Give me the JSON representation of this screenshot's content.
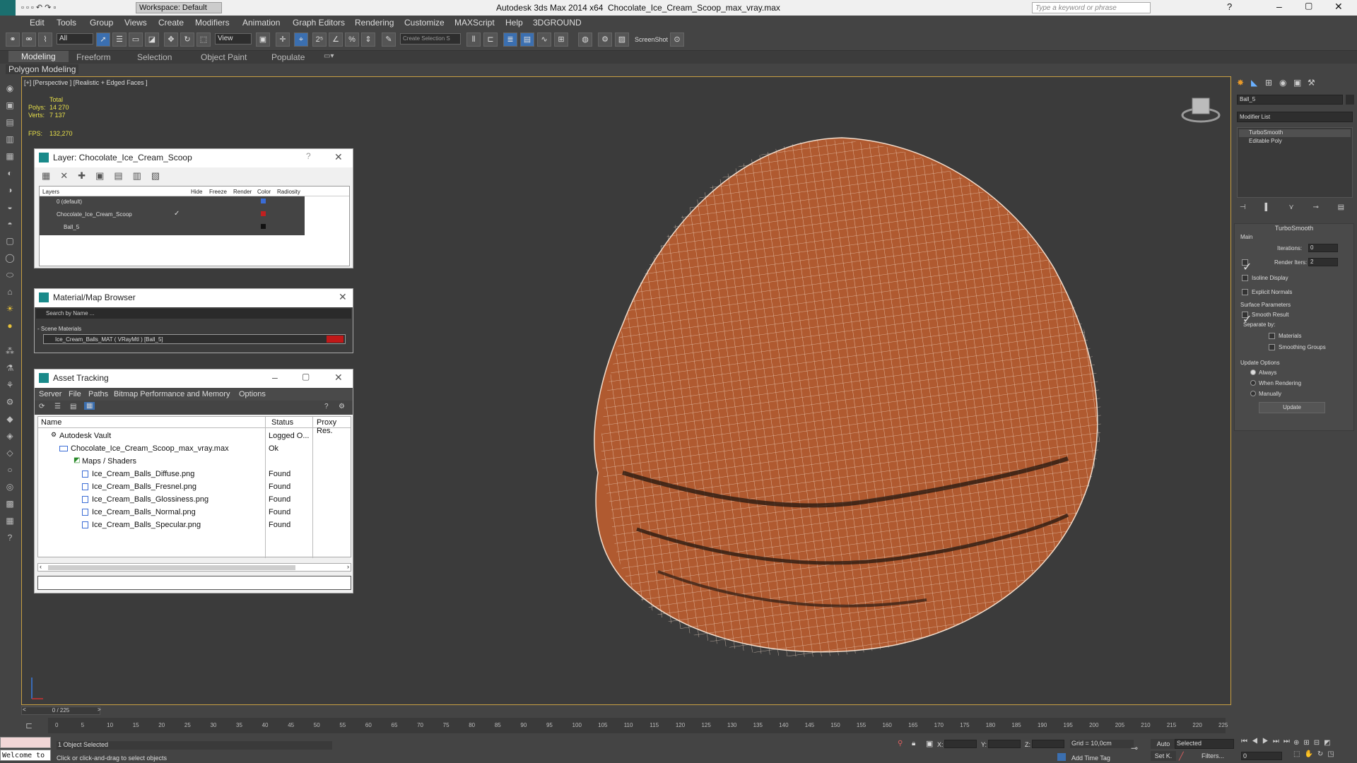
{
  "app": {
    "title": "Autodesk 3ds Max  2014 x64",
    "file": "Chocolate_Ice_Cream_Scoop_max_vray.max",
    "workspace": "Workspace: Default",
    "search_placeholder": "Type a keyword or phrase"
  },
  "menu": [
    "Edit",
    "Tools",
    "Group",
    "Views",
    "Create",
    "Modifiers",
    "Animation",
    "Graph Editors",
    "Rendering",
    "Customize",
    "MAXScript",
    "Help",
    "3DGROUND"
  ],
  "toolbar": {
    "filter": "All",
    "view": "View",
    "selection_set": "Create Selection S",
    "screenshot": "ScreenShot"
  },
  "ribbon": {
    "tabs": [
      "Modeling",
      "Freeform",
      "Selection",
      "Object Paint",
      "Populate"
    ],
    "sub": "Polygon Modeling"
  },
  "viewport": {
    "label": "[+] [Perspective ] [Realistic + Edged Faces ]",
    "stats": {
      "total": "Total",
      "polys_label": "Polys:",
      "polys": "14 270",
      "verts_label": "Verts:",
      "verts": "7 137",
      "fps_label": "FPS:",
      "fps": "132,270"
    }
  },
  "layer_dialog": {
    "title": "Layer: Chocolate_Ice_Cream_Scoop",
    "help": "?",
    "cols": [
      "Layers",
      "Hide",
      "Freeze",
      "Render",
      "Color",
      "Radiosity"
    ],
    "rows": [
      "0 (default)",
      "Chocolate_Ice_Cream_Scoop",
      "Ball_5"
    ]
  },
  "material_browser": {
    "title": "Material/Map Browser",
    "search": "Search by Name ...",
    "section": "- Scene Materials",
    "item": "Ice_Cream_Balls_MAT ( VRayMtl ) [Ball_5]"
  },
  "asset_tracking": {
    "title": "Asset Tracking",
    "menu": [
      "Server",
      "File",
      "Paths",
      "Bitmap Performance and Memory",
      "Options"
    ],
    "cols": [
      "Name",
      "Status",
      "Proxy Res."
    ],
    "rows": [
      {
        "name": "Autodesk Vault",
        "status": "Logged O..."
      },
      {
        "name": "Chocolate_Ice_Cream_Scoop_max_vray.max",
        "status": "Ok"
      },
      {
        "name": "Maps / Shaders",
        "status": ""
      },
      {
        "name": "Ice_Cream_Balls_Diffuse.png",
        "status": "Found"
      },
      {
        "name": "Ice_Cream_Balls_Fresnel.png",
        "status": "Found"
      },
      {
        "name": "Ice_Cream_Balls_Glossiness.png",
        "status": "Found"
      },
      {
        "name": "Ice_Cream_Balls_Normal.png",
        "status": "Found"
      },
      {
        "name": "Ice_Cream_Balls_Specular.png",
        "status": "Found"
      }
    ]
  },
  "command_panel": {
    "object_name": "Ball_5",
    "modifier_list": "Modifier List",
    "stack": [
      "TurboSmooth",
      "Editable Poly"
    ],
    "rollout": "TurboSmooth",
    "main": "Main",
    "iterations_label": "Iterations:",
    "iterations": "0",
    "render_iters_label": "Render Iters:",
    "render_iters": "2",
    "isoline": "Isoline Display",
    "explicit": "Explicit Normals",
    "surface": "Surface Parameters",
    "smooth_result": "Smooth Result",
    "separate": "Separate by:",
    "materials": "Materials",
    "smoothing": "Smoothing Groups",
    "update_opts": "Update Options",
    "always": "Always",
    "when_rendering": "When Rendering",
    "manually": "Manually",
    "update": "Update"
  },
  "timeline": {
    "frame": "0 / 225",
    "ticks": [
      "0",
      "5",
      "10",
      "15",
      "20",
      "25",
      "30",
      "35",
      "40",
      "45",
      "50",
      "55",
      "60",
      "65",
      "70",
      "75",
      "80",
      "85",
      "90",
      "95",
      "100",
      "105",
      "110",
      "115",
      "120",
      "125",
      "130",
      "135",
      "140",
      "145",
      "150",
      "155",
      "160",
      "165",
      "170",
      "175",
      "180",
      "185",
      "190",
      "195",
      "200",
      "205",
      "210",
      "215",
      "220",
      "225"
    ]
  },
  "status": {
    "welcome": "Welcome to",
    "selected": "1 Object Selected",
    "prompt": "Click or click-and-drag to select objects",
    "x_label": "X:",
    "y_label": "Y:",
    "z_label": "Z:",
    "grid": "Grid = 10,0cm",
    "auto": "Auto",
    "set_key": "Set K.",
    "key_mode": "Selected",
    "filters": "Filters...",
    "add_time_tag": "Add Time Tag",
    "frame_field": "0"
  },
  "colors": {
    "accent": "#c8a043",
    "mesh": "#b05a30",
    "wire": "#f2dccb"
  }
}
